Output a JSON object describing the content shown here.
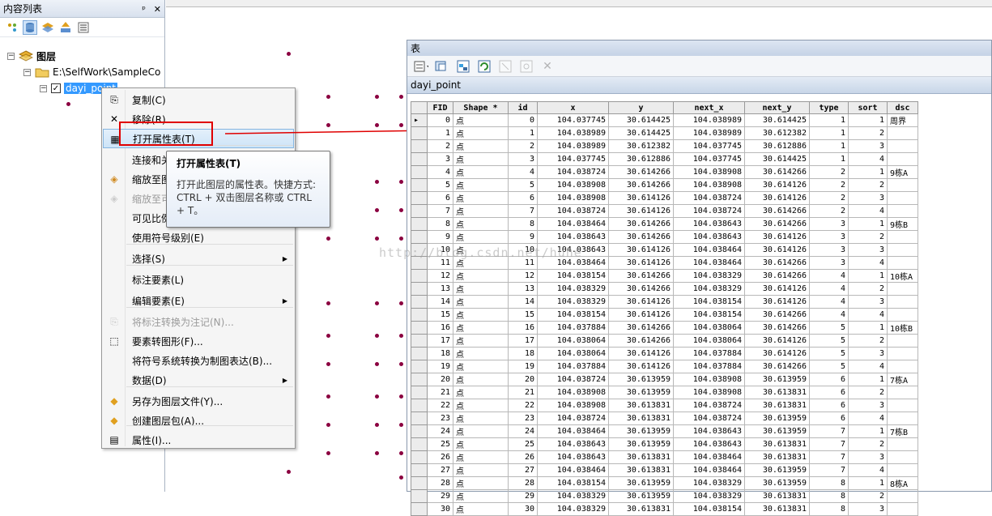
{
  "toc": {
    "title": "内容列表",
    "pin": "㵟",
    "close": "✕",
    "layers_label": "图层",
    "folder_label": "E:\\SelfWork\\SampleCo",
    "layer_name": "dayi_point"
  },
  "context_menu": {
    "items": [
      {
        "label": "复制(C)",
        "icon": "copy-icon"
      },
      {
        "label": "移除(R)",
        "icon": "remove-icon"
      },
      {
        "label": "打开属性表(T)",
        "icon": "table-icon"
      },
      {
        "label": "连接和关",
        "icon": ""
      },
      {
        "label": "缩放至图",
        "icon": "zoom-icon"
      },
      {
        "label": "缩放至可",
        "icon": "zoom-visible-icon"
      },
      {
        "label": "可见比例",
        "icon": ""
      },
      {
        "label": "使用符号级别(E)",
        "icon": ""
      },
      {
        "label": "选择(S)",
        "icon": ""
      },
      {
        "label": "标注要素(L)",
        "icon": ""
      },
      {
        "label": "编辑要素(E)",
        "icon": ""
      },
      {
        "label": "将标注转换为注记(N)...",
        "icon": "convert-label-icon"
      },
      {
        "label": "要素转图形(F)...",
        "icon": "feature-graphic-icon"
      },
      {
        "label": "将符号系统转换为制图表达(B)...",
        "icon": ""
      },
      {
        "label": "数据(D)",
        "icon": ""
      },
      {
        "label": "另存为图层文件(Y)...",
        "icon": "save-layer-icon"
      },
      {
        "label": "创建图层包(A)...",
        "icon": "layer-package-icon"
      },
      {
        "label": "属性(I)...",
        "icon": "properties-icon"
      }
    ]
  },
  "tooltip": {
    "title": "打开属性表(T)",
    "body": "打开此图层的属性表。快捷方式: CTRL + 双击图层名称或 CTRL + T。"
  },
  "table_window": {
    "title": "表",
    "tab": "dayi_point",
    "columns": [
      "FID",
      "Shape *",
      "id",
      "x",
      "y",
      "next_x",
      "next_y",
      "type",
      "sort",
      "dsc"
    ],
    "rows": [
      [
        "0",
        "点",
        "0",
        "104.037745",
        "30.614425",
        "104.038989",
        "30.614425",
        "1",
        "1",
        "周界"
      ],
      [
        "1",
        "点",
        "1",
        "104.038989",
        "30.614425",
        "104.038989",
        "30.612382",
        "1",
        "2",
        ""
      ],
      [
        "2",
        "点",
        "2",
        "104.038989",
        "30.612382",
        "104.037745",
        "30.612886",
        "1",
        "3",
        ""
      ],
      [
        "3",
        "点",
        "3",
        "104.037745",
        "30.612886",
        "104.037745",
        "30.614425",
        "1",
        "4",
        ""
      ],
      [
        "4",
        "点",
        "4",
        "104.038724",
        "30.614266",
        "104.038908",
        "30.614266",
        "2",
        "1",
        "9栋A"
      ],
      [
        "5",
        "点",
        "5",
        "104.038908",
        "30.614266",
        "104.038908",
        "30.614126",
        "2",
        "2",
        ""
      ],
      [
        "6",
        "点",
        "6",
        "104.038908",
        "30.614126",
        "104.038724",
        "30.614126",
        "2",
        "3",
        ""
      ],
      [
        "7",
        "点",
        "7",
        "104.038724",
        "30.614126",
        "104.038724",
        "30.614266",
        "2",
        "4",
        ""
      ],
      [
        "8",
        "点",
        "8",
        "104.038464",
        "30.614266",
        "104.038643",
        "30.614266",
        "3",
        "1",
        "9栋B"
      ],
      [
        "9",
        "点",
        "9",
        "104.038643",
        "30.614266",
        "104.038643",
        "30.614126",
        "3",
        "2",
        ""
      ],
      [
        "10",
        "点",
        "10",
        "104.038643",
        "30.614126",
        "104.038464",
        "30.614126",
        "3",
        "3",
        ""
      ],
      [
        "11",
        "点",
        "11",
        "104.038464",
        "30.614126",
        "104.038464",
        "30.614266",
        "3",
        "4",
        ""
      ],
      [
        "12",
        "点",
        "12",
        "104.038154",
        "30.614266",
        "104.038329",
        "30.614266",
        "4",
        "1",
        "10栋A"
      ],
      [
        "13",
        "点",
        "13",
        "104.038329",
        "30.614266",
        "104.038329",
        "30.614126",
        "4",
        "2",
        ""
      ],
      [
        "14",
        "点",
        "14",
        "104.038329",
        "30.614126",
        "104.038154",
        "30.614126",
        "4",
        "3",
        ""
      ],
      [
        "15",
        "点",
        "15",
        "104.038154",
        "30.614126",
        "104.038154",
        "30.614266",
        "4",
        "4",
        ""
      ],
      [
        "16",
        "点",
        "16",
        "104.037884",
        "30.614266",
        "104.038064",
        "30.614266",
        "5",
        "1",
        "10栋B"
      ],
      [
        "17",
        "点",
        "17",
        "104.038064",
        "30.614266",
        "104.038064",
        "30.614126",
        "5",
        "2",
        ""
      ],
      [
        "18",
        "点",
        "18",
        "104.038064",
        "30.614126",
        "104.037884",
        "30.614126",
        "5",
        "3",
        ""
      ],
      [
        "19",
        "点",
        "19",
        "104.037884",
        "30.614126",
        "104.037884",
        "30.614266",
        "5",
        "4",
        ""
      ],
      [
        "20",
        "点",
        "20",
        "104.038724",
        "30.613959",
        "104.038908",
        "30.613959",
        "6",
        "1",
        "7栋A"
      ],
      [
        "21",
        "点",
        "21",
        "104.038908",
        "30.613959",
        "104.038908",
        "30.613831",
        "6",
        "2",
        ""
      ],
      [
        "22",
        "点",
        "22",
        "104.038908",
        "30.613831",
        "104.038724",
        "30.613831",
        "6",
        "3",
        ""
      ],
      [
        "23",
        "点",
        "23",
        "104.038724",
        "30.613831",
        "104.038724",
        "30.613959",
        "6",
        "4",
        ""
      ],
      [
        "24",
        "点",
        "24",
        "104.038464",
        "30.613959",
        "104.038643",
        "30.613959",
        "7",
        "1",
        "7栋B"
      ],
      [
        "25",
        "点",
        "25",
        "104.038643",
        "30.613959",
        "104.038643",
        "30.613831",
        "7",
        "2",
        ""
      ],
      [
        "26",
        "点",
        "26",
        "104.038643",
        "30.613831",
        "104.038464",
        "30.613831",
        "7",
        "3",
        ""
      ],
      [
        "27",
        "点",
        "27",
        "104.038464",
        "30.613831",
        "104.038464",
        "30.613959",
        "7",
        "4",
        ""
      ],
      [
        "28",
        "点",
        "28",
        "104.038154",
        "30.613959",
        "104.038329",
        "30.613959",
        "8",
        "1",
        "8栋A"
      ],
      [
        "29",
        "点",
        "29",
        "104.038329",
        "30.613959",
        "104.038329",
        "30.613831",
        "8",
        "2",
        ""
      ],
      [
        "30",
        "点",
        "30",
        "104.038329",
        "30.613831",
        "104.038154",
        "30.613831",
        "8",
        "3",
        ""
      ]
    ]
  },
  "watermark": "http://blog.csdn.net/huhe"
}
